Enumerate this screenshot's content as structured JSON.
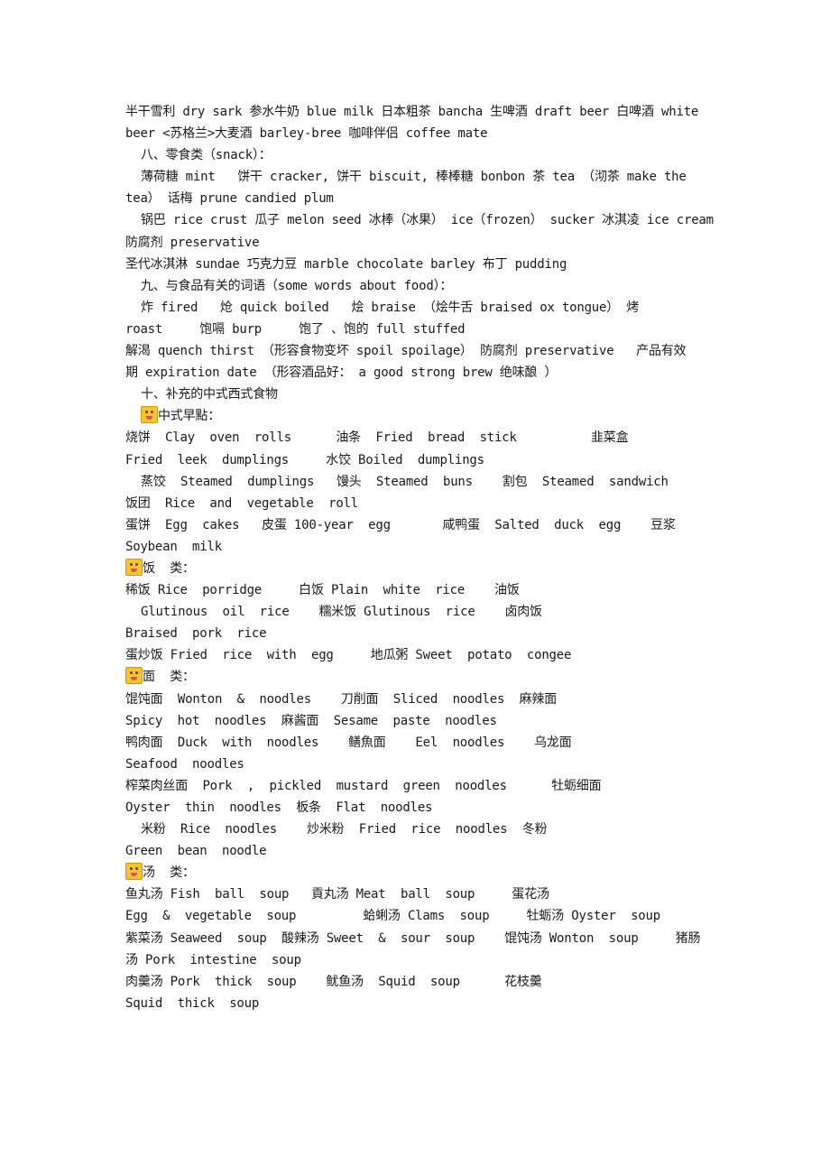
{
  "lines": [
    {
      "text": "半干雪利 dry sark 参水牛奶 blue milk 日本粗茶 bancha 生啤酒 draft beer 白啤酒 white"
    },
    {
      "text": "beer <苏格兰>大麦酒 barley-bree 咖啡伴侣 coffee mate"
    },
    {
      "text": "八、零食类（snack）："
    },
    {
      "text": "薄荷糖 mint   饼干 cracker, 饼干 biscuit, 棒棒糖 bonbon 茶 tea （沏茶 make the"
    },
    {
      "text": "tea） 话梅 prune candied plum"
    },
    {
      "text": "锅巴 rice crust 瓜子 melon seed 冰棒（冰果） ice（frozen） sucker 冰淇凌 ice cream"
    },
    {
      "text": "防腐剂 preservative"
    },
    {
      "text": "圣代冰淇淋 sundae 巧克力豆 marble chocolate barley 布丁 pudding"
    },
    {
      "text": "九、与食品有关的词语（some words about food）："
    },
    {
      "text": "炸 fired   炝 quick boiled   烩 braise （烩牛舌 braised ox tongue） 烤"
    },
    {
      "text": "roast     饱嗝 burp     饱了 、饱的 full stuffed"
    },
    {
      "text": "解渴 quench thirst （形容食物变坏 spoil spoilage） 防腐剂 preservative   产品有效"
    },
    {
      "text": "期 expiration date （形容酒品好： a good strong brew 绝味酿 ）"
    },
    {
      "text": "十、补充的中式西式食物"
    },
    {
      "text": "中式早點："
    },
    {
      "text": "烧饼  Clay  oven  rolls      油条  Fried  bread  stick          韭菜盒"
    },
    {
      "text": "Fried  leek  dumplings     水饺 Boiled  dumplings"
    },
    {
      "text": "蒸饺  Steamed  dumplings   馒头  Steamed  buns    割包  Steamed  sandwich"
    },
    {
      "text": "饭团  Rice  and  vegetable  roll"
    },
    {
      "text": "蛋饼  Egg  cakes   皮蛋 100-year  egg       咸鸭蛋  Salted  duck  egg    豆浆"
    },
    {
      "text": "Soybean  milk"
    },
    {
      "text": "饭  类："
    },
    {
      "text": "稀饭 Rice  porridge     白饭 Plain  white  rice    油饭"
    },
    {
      "text": "Glutinous  oil  rice    糯米饭 Glutinous  rice    卤肉饭"
    },
    {
      "text": "Braised  pork  rice"
    },
    {
      "text": "蛋炒饭 Fried  rice  with  egg     地瓜粥 Sweet  potato  congee"
    },
    {
      "text": "面  类："
    },
    {
      "text": "馄饨面  Wonton  &  noodles    刀削面  Sliced  noodles  麻辣面"
    },
    {
      "text": "Spicy  hot  noodles  麻酱面  Sesame  paste  noodles"
    },
    {
      "text": "鸭肉面  Duck  with  noodles    鳝魚面    Eel  noodles    乌龙面"
    },
    {
      "text": "Seafood  noodles"
    },
    {
      "text": "榨菜肉丝面  Pork  ,  pickled  mustard  green  noodles      牡蛎细面"
    },
    {
      "text": "Oyster  thin  noodles  板条  Flat  noodles"
    },
    {
      "text": "米粉  Rice  noodles    炒米粉  Fried  rice  noodles  冬粉"
    },
    {
      "text": "Green  bean  noodle"
    },
    {
      "text": "汤  类："
    },
    {
      "text": "鱼丸汤 Fish  ball  soup   貢丸汤 Meat  ball  soup     蛋花汤"
    },
    {
      "text": "Egg  &  vegetable  soup         蛤蜊汤 Clams  soup     牡蛎汤 Oyster  soup"
    },
    {
      "text": "紫菜汤 Seaweed  soup  酸辣汤 Sweet  &  sour  soup    馄饨汤 Wonton  soup     猪肠"
    },
    {
      "text": "汤 Pork  intestine  soup"
    },
    {
      "text": "肉羹汤 Pork  thick  soup    鱿鱼汤  Squid  soup      花枝羹"
    },
    {
      "text": "Squid  thick  soup"
    }
  ],
  "icons": {
    "breakfast": "smiley-face-icon",
    "rice": "tongue-face-icon",
    "noodles": "grinning-face-icon",
    "soup": "smiling-face-icon"
  }
}
